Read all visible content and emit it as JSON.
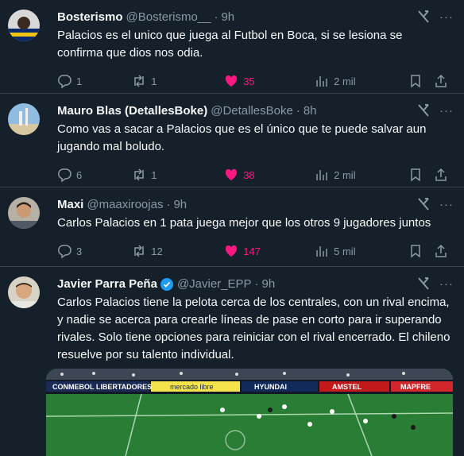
{
  "tweets": [
    {
      "name": "Bosterismo",
      "handle": "@Bosterismo__",
      "time": "9h",
      "text": "Palacios es el unico que juega al Futbol en Boca, si se lesiona se confirma que dios nos odia.",
      "replies": "1",
      "retweets": "1",
      "likes": "35",
      "views": "2 mil",
      "verified": false
    },
    {
      "name": "Mauro Blas (DetallesBoke)",
      "handle": "@DetallesBoke",
      "time": "8h",
      "text": "Como vas a sacar a Palacios que es el único que te puede salvar aun jugando mal boludo.",
      "replies": "6",
      "retweets": "1",
      "likes": "38",
      "views": "2 mil",
      "verified": false
    },
    {
      "name": "Maxi",
      "handle": "@maaxiroojas",
      "time": "9h",
      "text": "Carlos Palacios en 1 pata juega mejor que los otros 9 jugadores juntos",
      "replies": "3",
      "retweets": "12",
      "likes": "147",
      "views": "5 mil",
      "verified": false
    },
    {
      "name": "Javier Parra Peña",
      "handle": "@Javier_EPP",
      "time": "9h",
      "text": "Carlos Palacios tiene la pelota cerca de los centrales, con un rival encima, y nadie se acerca para crearle líneas de pase en corto para ir superando rivales. Solo tiene opciones para reiniciar con el rival encerrado. El chileno resuelve por su talento individual.",
      "verified": true
    }
  ],
  "dot": "·",
  "ads": [
    "CONMEBOL LIBERTADORES",
    "mercado libre",
    "HYUNDAI",
    "AMSTEL",
    "MAPFRE"
  ],
  "icons": {
    "reply": "reply-icon",
    "retweet": "retweet-icon",
    "like": "heart-filled-icon",
    "views": "views-icon",
    "bookmark": "bookmark-icon",
    "share": "share-icon",
    "grok": "grok-icon",
    "more": "more-icon"
  },
  "colors": {
    "background": "#15202b",
    "like": "#f91880",
    "muted": "#8b98a5",
    "verified": "#1d9bf0"
  }
}
